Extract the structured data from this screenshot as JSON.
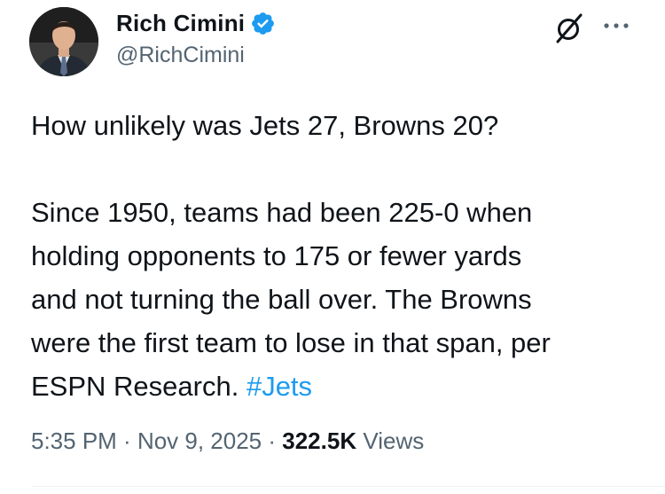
{
  "author": {
    "display_name": "Rich Cimini",
    "handle": "@RichCimini",
    "verified": true,
    "verified_color": "#1d9bf0"
  },
  "header_actions": {
    "grok_icon": "grok-slash-circle-icon",
    "more_icon": "more-dots-icon"
  },
  "tweet": {
    "line1": "How unlikely was Jets 27, Browns 20?",
    "line2": "Since 1950, teams had been 225-0 when",
    "line3": "holding opponents to 175 or fewer yards",
    "line4": "and not turning the ball over. The Browns",
    "line5": "were the first team to lose in that span, per",
    "line6": "ESPN Research.",
    "hashtag": "#Jets"
  },
  "meta": {
    "time": "5:35 PM",
    "sep1": " · ",
    "date": "Nov 9, 2025",
    "sep2": " · ",
    "views_count": "322.5K",
    "views_label": " Views"
  },
  "colors": {
    "text": "#0f1419",
    "secondary": "#536471",
    "link": "#1d9bf0"
  }
}
